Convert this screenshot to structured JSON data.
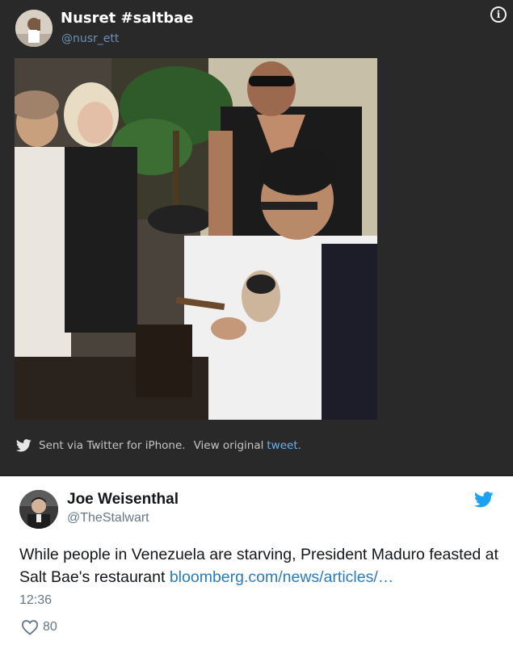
{
  "tweet1": {
    "author_name": "Nusret #saltbae",
    "author_handle": "@nusr_ett",
    "footer_source": "Sent via Twitter for iPhone.",
    "footer_view": "View original",
    "footer_link": "tweet.",
    "icons": [
      "avatar",
      "info-icon",
      "video-frame",
      "twitter-bird-icon"
    ],
    "colors": {
      "background": "#292929",
      "handle": "#6d8fb6",
      "link": "#6ab0f0"
    }
  },
  "tweet2": {
    "author_name": "Joe Weisenthal",
    "author_handle": "@TheStalwart",
    "text": "While people in Venezuela are starving, President Maduro feasted at Salt Bae's restaurant ",
    "link_text": "bloomberg.com/news/articles/…",
    "timestamp": "12:36",
    "like_count": "80",
    "icons": [
      "avatar",
      "twitter-bird-icon",
      "heart-icon"
    ],
    "colors": {
      "link": "#2b7bb9",
      "bird": "#1da1f2",
      "muted": "#657786"
    }
  }
}
